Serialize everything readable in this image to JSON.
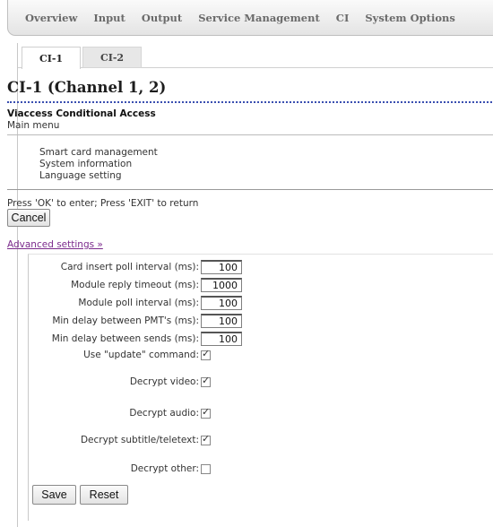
{
  "nav": {
    "items": [
      "Overview",
      "Input",
      "Output",
      "Service Management",
      "CI",
      "System Options"
    ]
  },
  "tabs": [
    {
      "label": "CI-1",
      "active": true
    },
    {
      "label": "CI-2",
      "active": false
    }
  ],
  "page": {
    "title": "CI-1 (Channel 1, 2)",
    "ca_title": "Viaccess Conditional Access",
    "ca_sub": "Main menu",
    "menu_items": [
      "Smart card management",
      "System information",
      "Language setting"
    ],
    "hint": "Press 'OK' to enter; Press 'EXIT' to return",
    "cancel_label": "Cancel",
    "advanced_link": "Advanced settings »"
  },
  "advanced": {
    "fields": [
      {
        "label": "Card insert poll interval (ms):",
        "value": "100"
      },
      {
        "label": "Module reply timeout (ms):",
        "value": "1000"
      },
      {
        "label": "Module poll interval (ms):",
        "value": "100"
      },
      {
        "label": "Min delay between PMT's (ms):",
        "value": "100"
      },
      {
        "label": "Min delay between sends (ms):",
        "value": "100"
      }
    ],
    "checkboxes": [
      {
        "label": "Use \"update\" command:",
        "checked": true
      },
      {
        "label": "Decrypt video:",
        "checked": true
      },
      {
        "label": "Decrypt audio:",
        "checked": true
      },
      {
        "label": "Decrypt subtitle/teletext:",
        "checked": true
      },
      {
        "label": "Decrypt other:",
        "checked": false
      }
    ],
    "save_label": "Save",
    "reset_label": "Reset"
  },
  "colors": {
    "link": "#7b2a8c",
    "title_rule": "#3a4fb0"
  }
}
